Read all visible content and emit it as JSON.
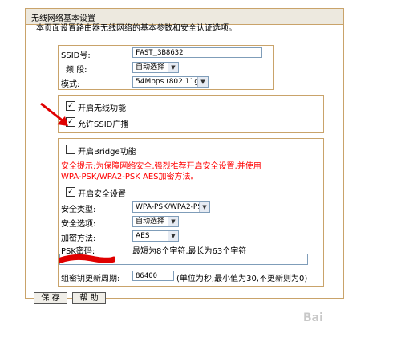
{
  "page": {
    "title": "无线网络基本设置",
    "intro": "本页面设置路由器无线网络的基本参数和安全认证选项。"
  },
  "basic": {
    "ssid_label": "SSID号:",
    "ssid_value": "FAST_3B8632",
    "band_label": "频 段:",
    "band_value": "自动选择",
    "mode_label": "模式:",
    "mode_value": "54Mbps (802.11g)"
  },
  "wireless": {
    "enable_label": "开启无线功能",
    "enable_checked": true,
    "ssid_broadcast_label": "允许SSID广播",
    "ssid_broadcast_checked": true
  },
  "bridge": {
    "label": "开启Bridge功能",
    "checked": false
  },
  "security": {
    "tip_line1": "安全提示:为保障网络安全,强烈推荐开启安全设置,并使用",
    "tip_line2": "WPA-PSK/WPA2-PSK AES加密方法。",
    "enable_label": "开启安全设置",
    "enable_checked": true,
    "type_label": "安全类型:",
    "type_value": "WPA-PSK/WPA2-PSK",
    "option_label": "安全选项:",
    "option_value": "自动选择",
    "encrypt_label": "加密方法:",
    "encrypt_value": "AES",
    "psk_label": "PSK密码:",
    "psk_hint": "最短为8个字符,最长为63个字符",
    "psk_value": "",
    "renew_label": "组密钥更新周期:",
    "renew_value": "86400",
    "renew_hint": "(单位为秒,最小值为30,不更新则为0)"
  },
  "buttons": {
    "save": "保 存",
    "help": "帮 助"
  },
  "watermark": "Bai"
}
